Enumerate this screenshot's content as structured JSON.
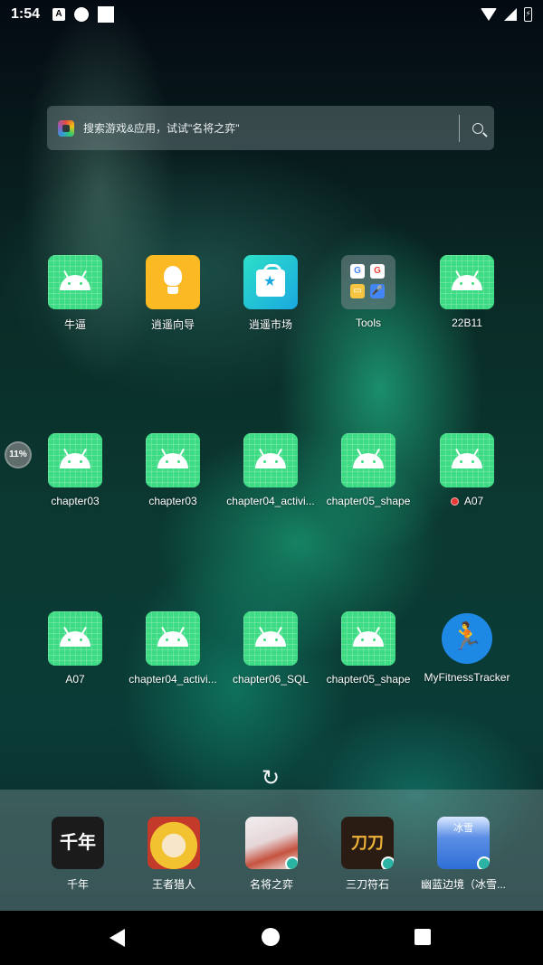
{
  "status_bar": {
    "time": "1:54",
    "notif_a": "A",
    "battery_label": "⚡"
  },
  "search": {
    "placeholder": "搜索游戏&应用，试试\"名将之弈\""
  },
  "apps": [
    {
      "label": "牛逼",
      "icon": "android-icon"
    },
    {
      "label": "逍遥向导",
      "icon": "lightbulb-icon"
    },
    {
      "label": "逍遥市场",
      "icon": "market-bag-icon"
    },
    {
      "label": "Tools",
      "icon": "tools-folder-icon"
    },
    {
      "label": "22B11",
      "icon": "android-icon"
    },
    {
      "label": "chapter03",
      "icon": "android-icon"
    },
    {
      "label": "chapter03",
      "icon": "android-icon"
    },
    {
      "label": "chapter04_activi...",
      "icon": "android-icon"
    },
    {
      "label": "chapter05_shape",
      "icon": "android-icon"
    },
    {
      "label": "A07",
      "icon": "android-icon"
    },
    {
      "label": "A07",
      "icon": "android-icon"
    },
    {
      "label": "chapter04_activi...",
      "icon": "android-icon"
    },
    {
      "label": "chapter06_SQL",
      "icon": "android-icon"
    },
    {
      "label": "chapter05_shape",
      "icon": "android-icon"
    },
    {
      "label": "MyFitnessTracker",
      "icon": "runner-icon"
    }
  ],
  "tools_folder": {
    "mini_apps": [
      "G",
      "G",
      "▭",
      "🎤"
    ]
  },
  "progress_badge": "11%",
  "dock": [
    {
      "label": "千年",
      "icon": "qiannian-game-icon",
      "art": "千年",
      "color": "#1b1b1b"
    },
    {
      "label": "王者猎人",
      "icon": "wangzhe-lieren-game-icon",
      "art": "",
      "color": "#f2c230"
    },
    {
      "label": "名将之弈",
      "icon": "mingjiang-zhiyi-game-icon",
      "art": "",
      "color": "#e7dfe0"
    },
    {
      "label": "三刀符石",
      "icon": "sandao-fushi-game-icon",
      "art": "刀刀",
      "color": "#2a1c12"
    },
    {
      "label": "幽蓝边境（冰雪...",
      "icon": "youlan-bianjing-game-icon",
      "art": "冰雪",
      "color": "#2d6fd6"
    }
  ],
  "colors": {
    "android_green": "#3ddc84",
    "fitness_blue": "#1e88e5",
    "dock_badge": "#2bb3a3"
  }
}
